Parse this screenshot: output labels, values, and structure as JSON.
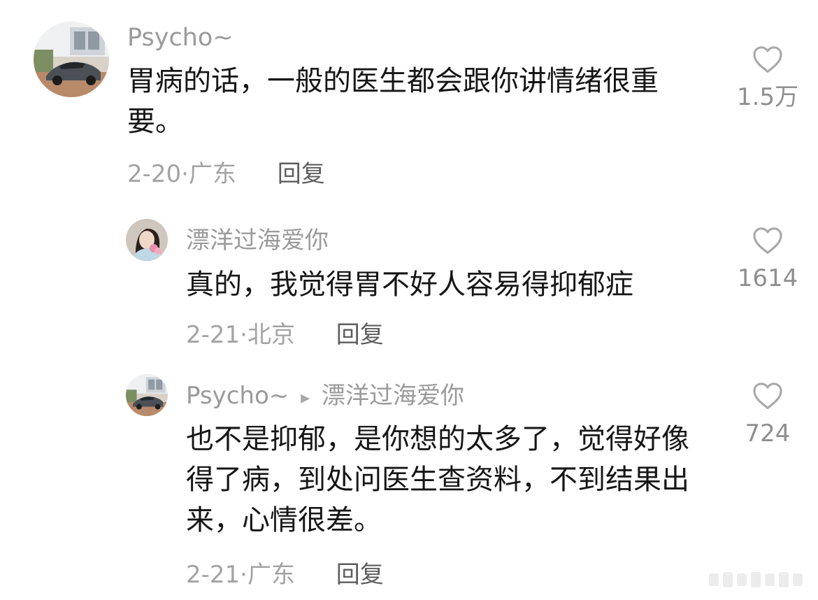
{
  "comments": [
    {
      "username": "Psycho~",
      "text": "胃病的话，一般的医生都会跟你讲情绪很重要。",
      "date": "2-20",
      "dot": "·",
      "location": "广东",
      "reply_label": "回复",
      "likes": "1.5万"
    },
    {
      "username": "漂洋过海爱你",
      "text": "真的，我觉得胃不好人容易得抑郁症",
      "date": "2-21",
      "dot": "·",
      "location": "北京",
      "reply_label": "回复",
      "likes": "1614"
    },
    {
      "username": "Psycho~",
      "reply_arrow": "▸",
      "reply_to": "漂洋过海爱你",
      "text": "也不是抑郁，是你想的太多了，觉得好像得了病，到处问医生查资料，不到结果出来，心情很差。",
      "date": "2-21",
      "dot": "·",
      "location": "广东",
      "reply_label": "回复",
      "likes": "724"
    }
  ],
  "icons": {
    "like": "heart-outline-icon"
  },
  "colors": {
    "username": "#9a9a9a",
    "meta": "#a3a3a3",
    "text": "#161616",
    "likes": "#8f8f8f"
  }
}
